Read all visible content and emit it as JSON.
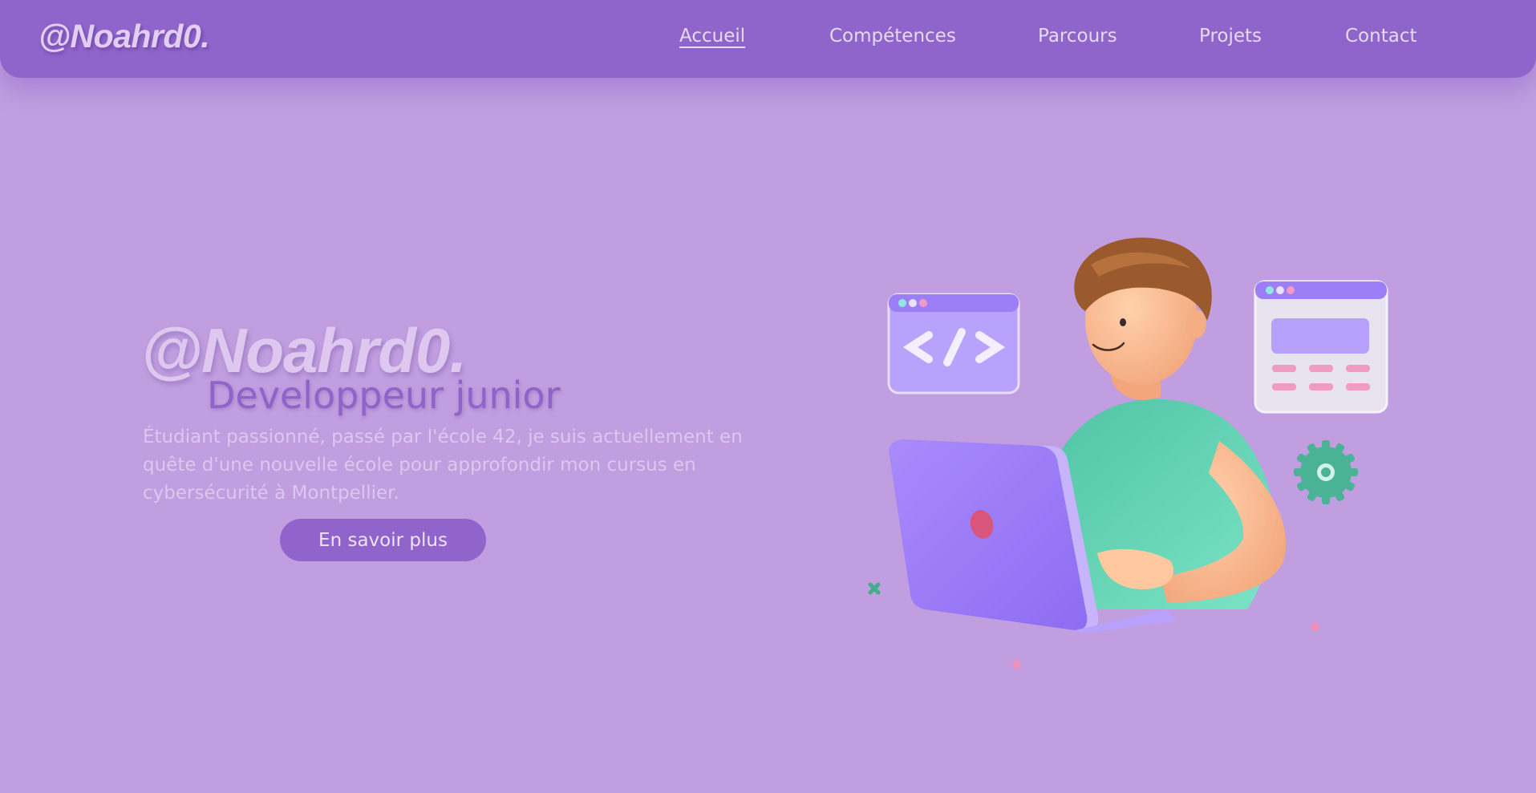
{
  "header": {
    "logo": "@Noahrd0.",
    "nav": [
      {
        "label": "Accueil",
        "active": true
      },
      {
        "label": "Compétences",
        "active": false
      },
      {
        "label": "Parcours",
        "active": false
      },
      {
        "label": "Projets",
        "active": false
      },
      {
        "label": "Contact",
        "active": false
      }
    ]
  },
  "hero": {
    "name": "@Noahrd0.",
    "role": "Developpeur junior",
    "description": "Étudiant passionné, passé par l'école 42, je suis actuellement en quête d'une nouvelle école pour approfondir mon cursus en cybersécurité à Montpellier.",
    "cta_label": "En savoir plus"
  },
  "illustration": {
    "code_window_icon": "code-brackets-icon",
    "code_text": "</>",
    "icons": [
      "code-window-icon",
      "ui-window-icon",
      "gear-icon",
      "laptop-icon",
      "sparkle-icon"
    ]
  },
  "colors": {
    "background": "#c09edf",
    "header": "#9065cb",
    "accent": "#9064cb",
    "shirt": "#5fd3b4",
    "laptop": "#9b7bf7"
  }
}
